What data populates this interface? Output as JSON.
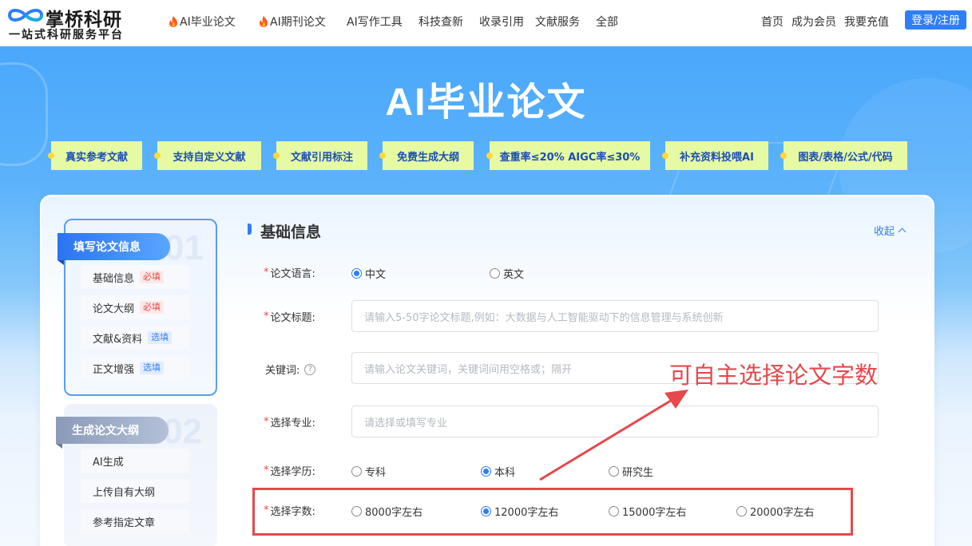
{
  "brand": {
    "name": "掌桥科研",
    "tagline": "一站式科研服务平台"
  },
  "nav": {
    "items": [
      "AI毕业论文",
      "AI期刊论文",
      "AI写作工具",
      "科技查新",
      "收录引用",
      "文献服务",
      "全部"
    ],
    "right": [
      "首页",
      "成为会员",
      "我要充值"
    ],
    "login": "登录/注册"
  },
  "hero": {
    "title": "AI毕业论文",
    "tags": [
      "真实参考文献",
      "支持自定义文献",
      "文献引用标注",
      "免费生成大纲",
      "查重率≤20%  AIGC率≤30%",
      "补充资料投喂AI",
      "图表/表格/公式/代码"
    ]
  },
  "sidebar": {
    "step1": {
      "num": "01",
      "title": "填写论文信息",
      "items": [
        {
          "label": "基础信息",
          "badge": "必填"
        },
        {
          "label": "论文大纲",
          "badge": "必填"
        },
        {
          "label": "文献&资料",
          "badge": "选填"
        },
        {
          "label": "正文增强",
          "badge": "选填"
        }
      ]
    },
    "step2": {
      "num": "02",
      "title": "生成论文大纲",
      "items": [
        "AI生成",
        "上传自有大纲",
        "参考指定文章"
      ]
    }
  },
  "form": {
    "section_title": "基础信息",
    "collapse": "收起",
    "language": {
      "label": "论文语言:",
      "options": [
        "中文",
        "英文"
      ],
      "selected": 0
    },
    "title": {
      "label": "论文标题:",
      "placeholder": "请输入5-50字论文标题,例如：大数据与人工智能驱动下的信息管理与系统创新"
    },
    "keywords": {
      "label": "关键词:",
      "placeholder": "请输入论文关键词，关键词间用空格或；隔开"
    },
    "major": {
      "label": "选择专业:",
      "placeholder": "请选择或填写专业"
    },
    "degree": {
      "label": "选择学历:",
      "options": [
        "专科",
        "本科",
        "研究生"
      ],
      "selected": 1
    },
    "wordcount": {
      "label": "选择字数:",
      "options": [
        "8000字左右",
        "12000字左右",
        "15000字左右",
        "20000字左右"
      ],
      "selected": 1
    }
  },
  "annotation": {
    "text": "可自主选择论文字数",
    "color": "#e5484d"
  },
  "colors": {
    "primary": "#2f7ef7",
    "tag_bg": "#e6f9a3",
    "tag_text": "#1b4fb4",
    "required": "#e24b4b"
  }
}
